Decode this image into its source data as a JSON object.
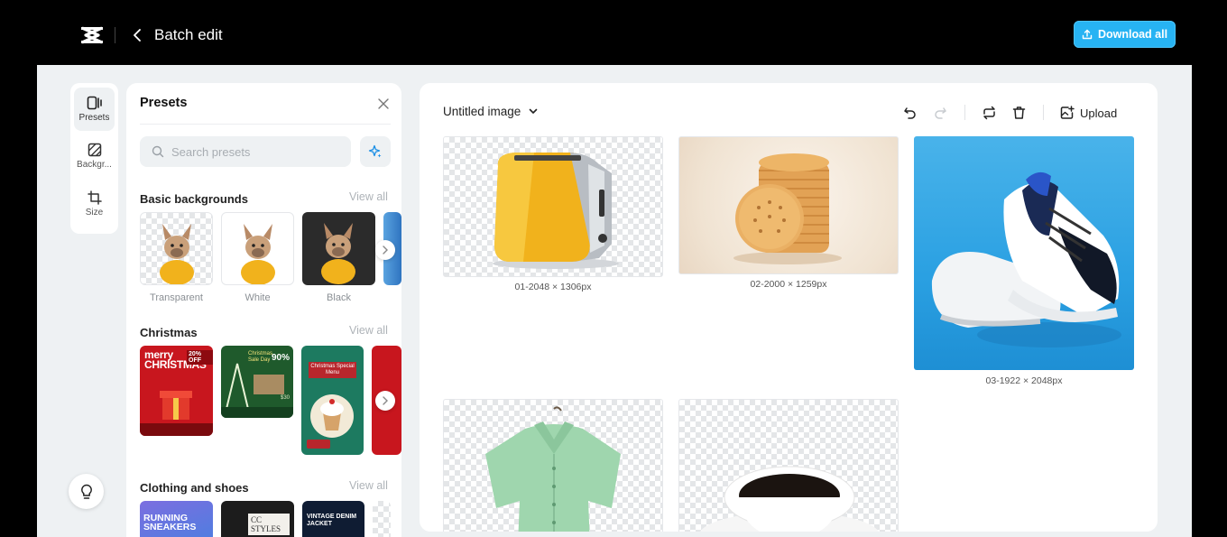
{
  "header": {
    "title": "Batch edit",
    "download_label": "Download all",
    "logo_icon": "capcut-logo-icon",
    "accent_color": "#27b3f3"
  },
  "rail": {
    "items": [
      {
        "label": "Presets",
        "icon": "presets-icon",
        "active": true
      },
      {
        "label": "Backgr...",
        "icon": "background-icon",
        "active": false
      },
      {
        "label": "Size",
        "icon": "crop-icon",
        "active": false
      }
    ],
    "help_icon": "lightbulb-icon"
  },
  "presets": {
    "title": "Presets",
    "search_placeholder": "Search presets",
    "sections": [
      {
        "title": "Basic backgrounds",
        "view_all": "View all",
        "items": [
          {
            "caption": "Transparent"
          },
          {
            "caption": "White"
          },
          {
            "caption": "Black"
          }
        ]
      },
      {
        "title": "Christmas",
        "view_all": "View all",
        "items": [
          {
            "text": "merry CHRISTMAS",
            "badge": "20% OFF"
          },
          {
            "text": "Christmas Sale Day",
            "badge": "90%",
            "price": "$30"
          },
          {
            "text": "Christmas Special Menu"
          }
        ]
      },
      {
        "title": "Clothing and shoes",
        "view_all": "View all",
        "items": [
          {
            "text": "RUNNING SNEAKERS"
          },
          {
            "text": "CC STYLES"
          },
          {
            "text": "VINTAGE DENIM JACKET"
          }
        ]
      }
    ]
  },
  "canvas": {
    "document_name": "Untitled image",
    "upload_label": "Upload",
    "images": [
      {
        "caption": "01-2048 × 1306px",
        "subject": "yellow toaster",
        "background": "transparent"
      },
      {
        "caption": "02-2000 × 1259px",
        "subject": "stack of crackers",
        "background": "cream"
      },
      {
        "caption": "03-1922 × 2048px",
        "subject": "sneakers",
        "background": "blue"
      },
      {
        "caption": "",
        "subject": "green shirt",
        "background": "transparent"
      },
      {
        "caption": "",
        "subject": "coffee cup",
        "background": "transparent"
      }
    ]
  }
}
